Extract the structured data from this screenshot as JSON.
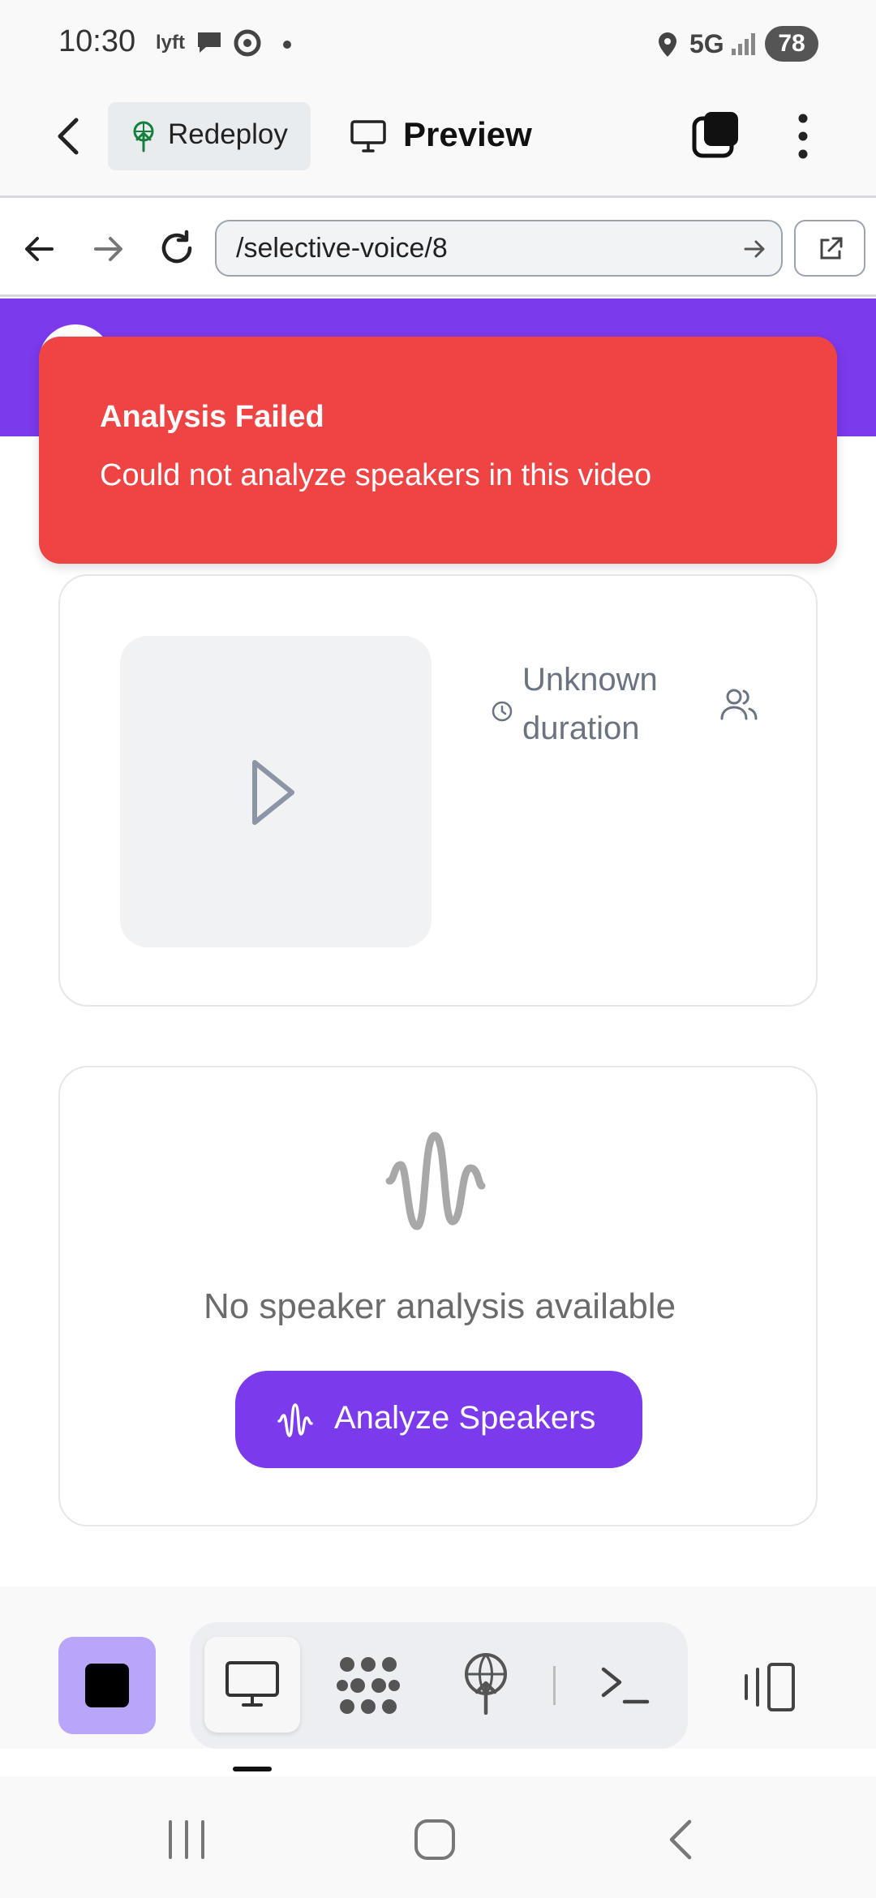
{
  "status_bar": {
    "time": "10:30",
    "network": "5G",
    "battery": "78"
  },
  "header": {
    "redeploy_label": "Redeploy",
    "preview_label": "Preview"
  },
  "browser": {
    "url": "/selective-voice/8"
  },
  "toast": {
    "title": "Analysis Failed",
    "message": "Could not analyze speakers in this video"
  },
  "video_card": {
    "duration": "Unknown duration"
  },
  "speaker_card": {
    "empty_message": "No speaker analysis available",
    "analyze_button": "Analyze Speakers"
  },
  "colors": {
    "accent": "#7c3aed",
    "error": "#ef4444"
  }
}
